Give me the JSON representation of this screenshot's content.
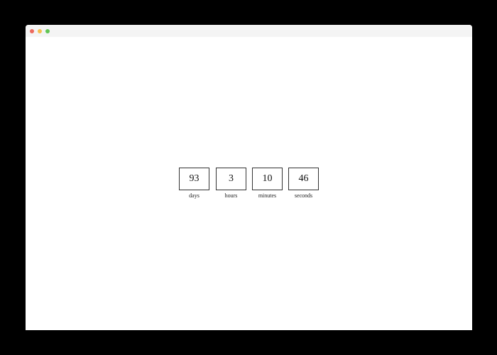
{
  "window": {
    "traffic_lights": {
      "close_color": "#ed6a5e",
      "minimize_color": "#f5bf4f",
      "zoom_color": "#61c554"
    }
  },
  "countdown": {
    "units": [
      {
        "value": "93",
        "label": "days"
      },
      {
        "value": "3",
        "label": "hours"
      },
      {
        "value": "10",
        "label": "minutes"
      },
      {
        "value": "46",
        "label": "seconds"
      }
    ]
  }
}
